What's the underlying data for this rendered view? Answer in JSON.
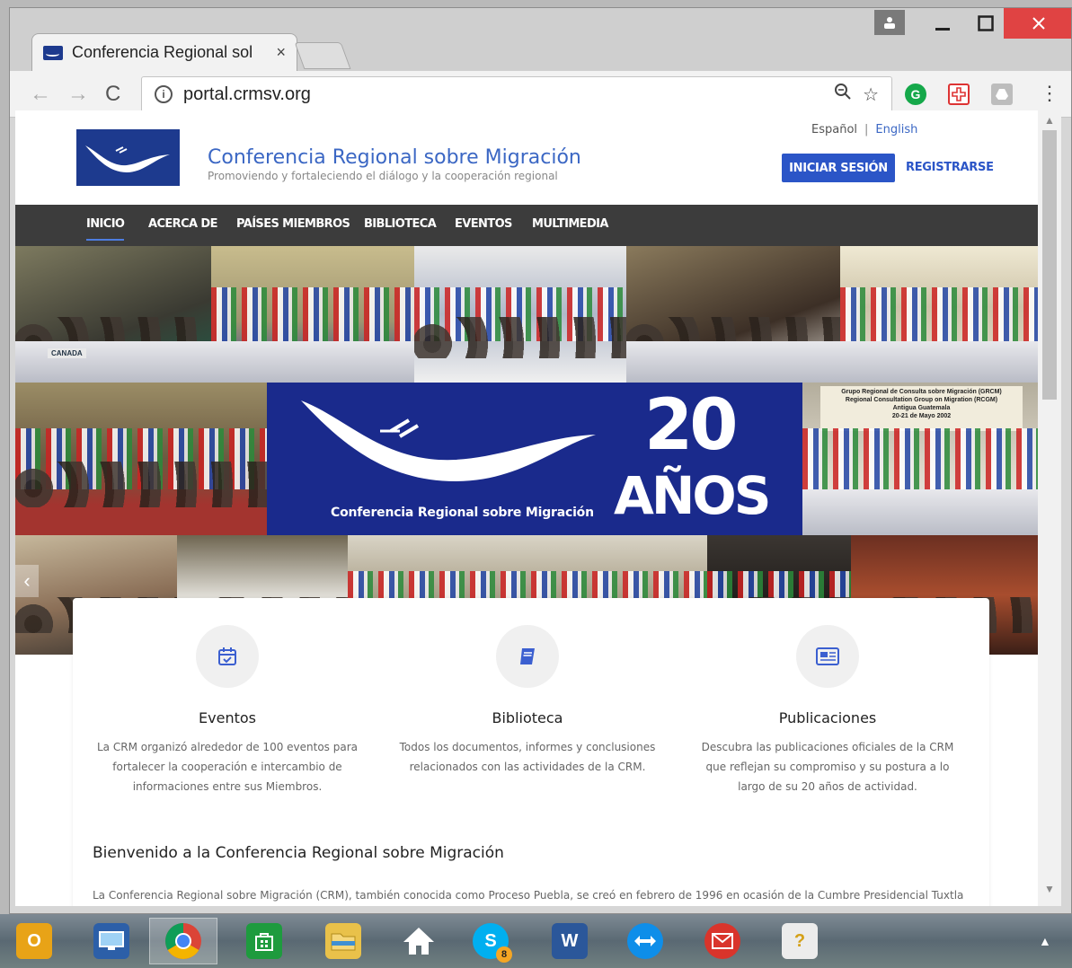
{
  "browser": {
    "tab_title": "Conferencia Regional sol",
    "tab_close": "×",
    "url": "portal.crmsv.org",
    "extension_g": "G"
  },
  "site": {
    "title": "Conferencia Regional sobre Migración",
    "subtitle": "Promoviendo y fortaleciendo el diálogo y la cooperación regional",
    "lang_es": "Español",
    "lang_sep": "|",
    "lang_en": "English",
    "login_label": "INICIAR SESIÓN",
    "register_label": "REGISTRARSE"
  },
  "nav": {
    "items": [
      {
        "label": "INICIO",
        "active": true
      },
      {
        "label": "ACERCA DE"
      },
      {
        "label": "PAÍSES MIEMBROS"
      },
      {
        "label": "BIBLIOTECA"
      },
      {
        "label": "EVENTOS"
      },
      {
        "label": "MULTIMEDIA"
      }
    ]
  },
  "hero": {
    "banner_caption": "Conferencia Regional sobre Migración",
    "banner_number": "20",
    "banner_word": "AÑOS",
    "photo_tag_canada": "CANADA",
    "photo_sign_line1": "Grupo Regional de Consulta sobre Migración (GRCM)",
    "photo_sign_line2": "Regional Consultation Group on Migration (RCGM)",
    "photo_sign_line3": "Antigua Guatemala",
    "photo_sign_line4": "20-21 de Mayo 2002",
    "slide_count": 2,
    "active_slide": 1
  },
  "features": [
    {
      "icon": "calendar-check-icon",
      "title": "Eventos",
      "description": "La CRM organizó alrededor de 100 eventos para fortalecer la cooperación e intercambio de informaciones entre sus Miembros."
    },
    {
      "icon": "book-icon",
      "title": "Biblioteca",
      "description": "Todos los documentos, informes y conclusiones relacionados con las actividades de la CRM."
    },
    {
      "icon": "newspaper-icon",
      "title": "Publicaciones",
      "description": "Descubra las publicaciones oficiales de la CRM que reflejan su compromiso y su postura a lo largo de su 20 años de actividad."
    }
  ],
  "welcome": {
    "title": "Bienvenido a la Conferencia Regional sobre Migración",
    "text": "La Conferencia Regional sobre Migración (CRM), también conocida como Proceso Puebla, se creó en febrero de 1996 en ocasión de la Cumbre Presidencial Tuxtla"
  },
  "taskbar": {
    "items": [
      "outlook-icon",
      "remote-desktop-icon",
      "chrome-icon",
      "store-icon",
      "file-explorer-icon",
      "home-icon",
      "skype-icon",
      "word-icon",
      "teamviewer-icon",
      "mail-icon",
      "help-icon"
    ],
    "skype_badge": "8"
  },
  "colors": {
    "brand_blue": "#1d3a8e",
    "link_blue": "#3b67c4",
    "button_blue": "#2b55c7",
    "nav_bg": "#3c3c3c",
    "close_red": "#e04343"
  }
}
